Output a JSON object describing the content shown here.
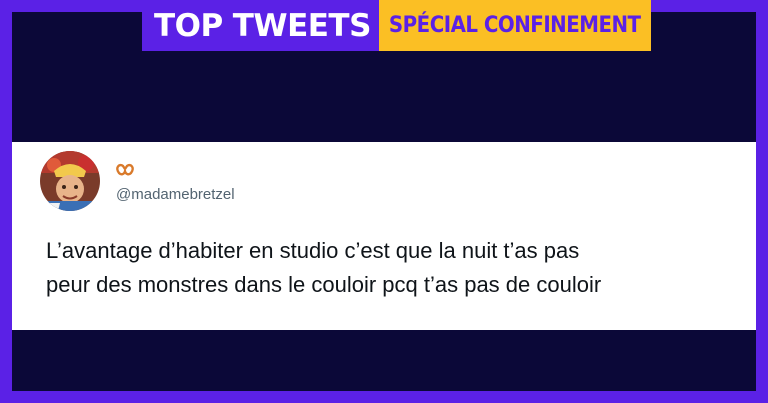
{
  "banner": {
    "title_part1": "TOP",
    "title_part2": "TWEETS",
    "subtitle": "SPÉCIAL CONFINEMENT"
  },
  "tweet": {
    "display_name_icon": "pretzel-emoji",
    "handle": "@madamebretzel",
    "text_line1": "L’avantage d’habiter en studio c’est que la nuit t’as pas",
    "text_line2": "peur des monstres dans le couloir pcq t’as pas de couloir"
  },
  "colors": {
    "frame": "#5b21e6",
    "background": "#0b0838",
    "accent_yellow": "#fbbf24",
    "card": "#ffffff"
  }
}
